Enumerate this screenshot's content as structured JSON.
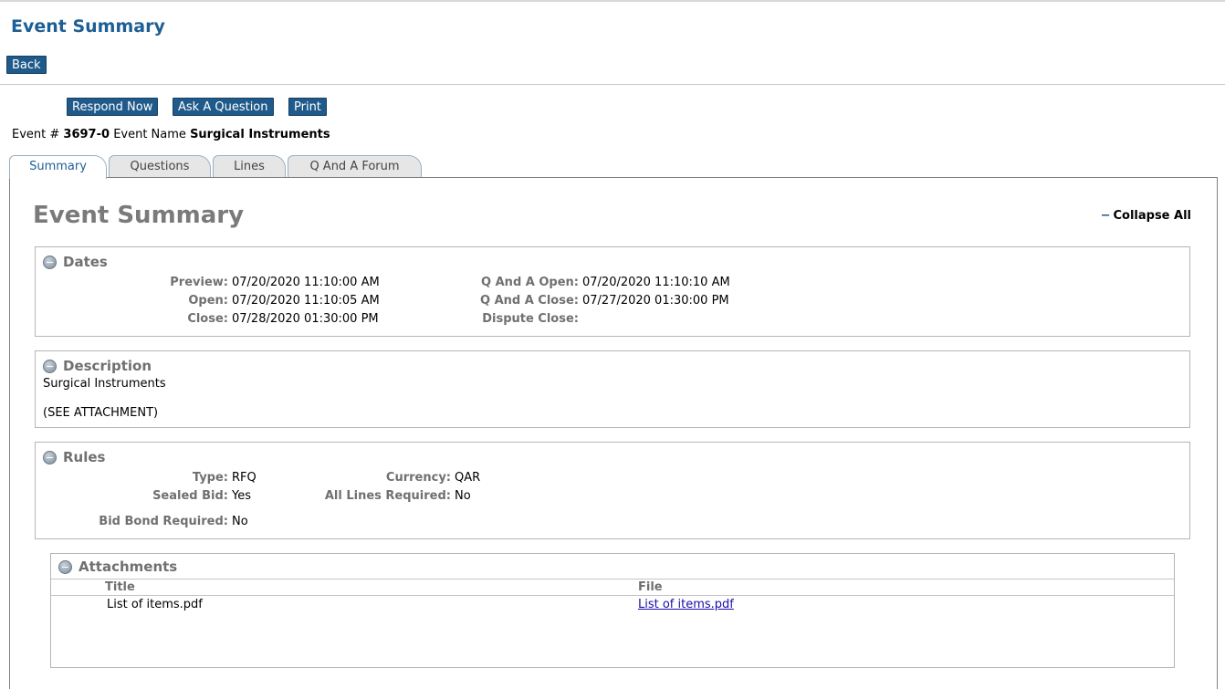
{
  "page": {
    "title": "Event Summary",
    "back_label": "Back"
  },
  "actions": {
    "respond_now": "Respond Now",
    "ask_question": "Ask A Question",
    "print": "Print"
  },
  "event": {
    "number_label": "Event #",
    "number": "3697-0",
    "name_label": "Event Name",
    "name": "Surgical Instruments"
  },
  "tabs": [
    {
      "label": "Summary",
      "active": true
    },
    {
      "label": "Questions",
      "active": false
    },
    {
      "label": "Lines",
      "active": false
    },
    {
      "label": "Q And A Forum",
      "active": false
    }
  ],
  "summary": {
    "title": "Event Summary",
    "collapse_all": "Collapse All"
  },
  "dates": {
    "heading": "Dates",
    "preview_label": "Preview:",
    "preview": "07/20/2020 11:10:00 AM",
    "open_label": "Open:",
    "open": "07/20/2020 11:10:05 AM",
    "close_label": "Close:",
    "close": "07/28/2020 01:30:00 PM",
    "qa_open_label": "Q And A Open:",
    "qa_open": "07/20/2020 11:10:10 AM",
    "qa_close_label": "Q And A Close:",
    "qa_close": "07/27/2020 01:30:00 PM",
    "dispute_close_label": "Dispute Close:",
    "dispute_close": ""
  },
  "description": {
    "heading": "Description",
    "line1": "Surgical Instruments",
    "line2": "(SEE ATTACHMENT)"
  },
  "rules": {
    "heading": "Rules",
    "type_label": "Type:",
    "type": "RFQ",
    "sealed_label": "Sealed Bid:",
    "sealed": "Yes",
    "bond_label": "Bid Bond Required:",
    "bond": "No",
    "currency_label": "Currency:",
    "currency": "QAR",
    "all_lines_label": "All Lines Required:",
    "all_lines": "No"
  },
  "attachments": {
    "heading": "Attachments",
    "col_title": "Title",
    "col_file": "File",
    "rows": [
      {
        "title": "List of items.pdf",
        "file": "List of items.pdf"
      }
    ]
  },
  "colors": {
    "brand_blue": "#1f5a8a",
    "title_blue": "#1d5f95",
    "label_gray": "#707070",
    "link_blue": "#1a0dab"
  }
}
